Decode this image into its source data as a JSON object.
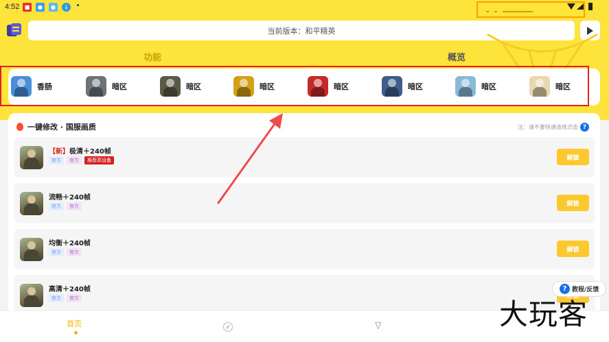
{
  "status_bar": {
    "time": "4:52",
    "app_icons": [
      "red-notification-icon",
      "game-app-icon",
      "chat-app-icon",
      "download-icon"
    ]
  },
  "header": {
    "version_text": "当前版本：和平精英"
  },
  "tabs": [
    {
      "label": "功能",
      "active": true
    },
    {
      "label": "概览",
      "active": false
    }
  ],
  "games": [
    {
      "label": "香肠",
      "color": "#4a8fd8"
    },
    {
      "label": "暗区",
      "color": "#6b7478"
    },
    {
      "label": "暗区",
      "color": "#5a5a48"
    },
    {
      "label": "暗区",
      "color": "#d4a017"
    },
    {
      "label": "暗区",
      "color": "#c42a2a"
    },
    {
      "label": "暗区",
      "color": "#3d5f8a"
    },
    {
      "label": "暗区",
      "color": "#8ab8d8"
    },
    {
      "label": "暗区",
      "color": "#e8d8b0"
    }
  ],
  "section": {
    "title": "一键修改 · 国服画质",
    "note": "注：请不要快速连续点击",
    "help_glyph": "?"
  },
  "options": [
    {
      "prefix": "【新】",
      "title": "极清＋240帧",
      "tags": [
        "官方",
        "官方",
        "推荐高设备"
      ],
      "unlock": "解锁"
    },
    {
      "prefix": "",
      "title": "流畅＋240帧",
      "tags": [
        "官方",
        "官方"
      ],
      "unlock": "解锁"
    },
    {
      "prefix": "",
      "title": "均衡＋240帧",
      "tags": [
        "官方",
        "官方"
      ],
      "unlock": "解锁"
    },
    {
      "prefix": "",
      "title": "高清＋240帧",
      "tags": [
        "官方",
        "官方"
      ],
      "unlock": "解锁"
    }
  ],
  "help_button": {
    "label": "教程/反馈",
    "glyph": "?"
  },
  "bottom_nav": {
    "home": "首页",
    "tab2_icon": "compass-icon",
    "tab3_icon": "v-icon",
    "tab3_glyph": "∇"
  },
  "watermark": "大玩客",
  "colors": {
    "brand_yellow": "#fde33a",
    "unlock_yellow": "#fcc82e",
    "highlight_red": "#e02020",
    "highlight_orange": "#f7a100"
  }
}
